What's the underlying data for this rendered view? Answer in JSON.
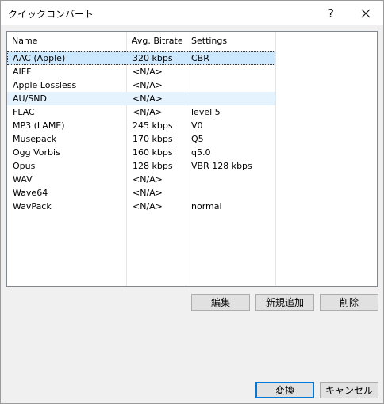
{
  "window": {
    "title": "クイックコンバート",
    "help_glyph": "?"
  },
  "list": {
    "columns": [
      "Name",
      "Avg. Bitrate",
      "Settings"
    ],
    "rows": [
      {
        "name": "AAC (Apple)",
        "bitrate": "320 kbps",
        "settings": "CBR"
      },
      {
        "name": "AIFF",
        "bitrate": "<N/A>",
        "settings": ""
      },
      {
        "name": "Apple Lossless",
        "bitrate": "<N/A>",
        "settings": ""
      },
      {
        "name": "AU/SND",
        "bitrate": "<N/A>",
        "settings": ""
      },
      {
        "name": "FLAC",
        "bitrate": "<N/A>",
        "settings": "level 5"
      },
      {
        "name": "MP3 (LAME)",
        "bitrate": "245 kbps",
        "settings": "V0"
      },
      {
        "name": "Musepack",
        "bitrate": "170 kbps",
        "settings": "Q5"
      },
      {
        "name": "Ogg Vorbis",
        "bitrate": "160 kbps",
        "settings": "q5.0"
      },
      {
        "name": "Opus",
        "bitrate": "128 kbps",
        "settings": "VBR 128 kbps"
      },
      {
        "name": "WAV",
        "bitrate": "<N/A>",
        "settings": ""
      },
      {
        "name": "Wave64",
        "bitrate": "<N/A>",
        "settings": ""
      },
      {
        "name": "WavPack",
        "bitrate": "<N/A>",
        "settings": "normal"
      }
    ]
  },
  "buttons": {
    "edit": "編集",
    "add_new": "新規追加",
    "delete": "削除",
    "convert": "変換",
    "cancel": "キャンセル"
  },
  "colors": {
    "selection": "#cce8ff",
    "hover": "#e5f3ff",
    "default_button_border": "#0078d7"
  }
}
